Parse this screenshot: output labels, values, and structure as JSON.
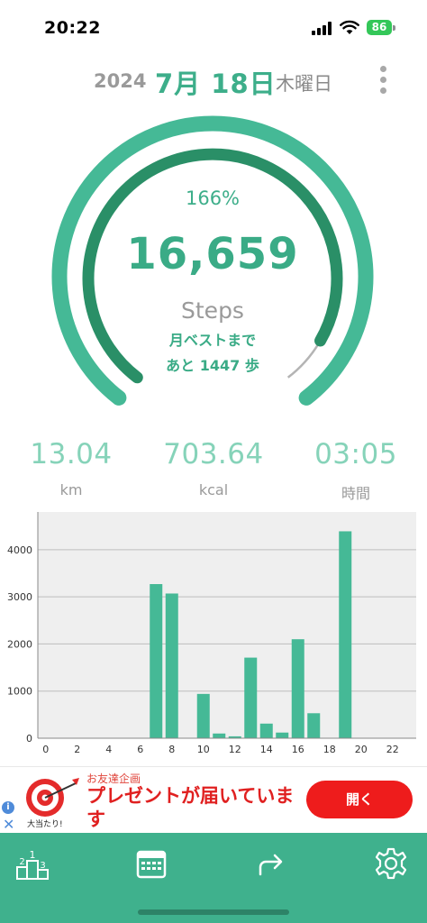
{
  "status": {
    "time": "20:22",
    "battery": "86"
  },
  "header": {
    "year": "2024",
    "date": "7月 18日",
    "weekday": "木曜日"
  },
  "gauge": {
    "percent_text": "166%",
    "steps": "16,659",
    "unit": "Steps",
    "note_line1": "月ベストまで",
    "note_line2": "あと 1447 歩",
    "progress_fraction": 0.92
  },
  "stats": [
    {
      "value": "13.04",
      "label": "km"
    },
    {
      "value": "703.64",
      "label": "kcal"
    },
    {
      "value": "03:05",
      "label": "時間"
    }
  ],
  "chart_data": {
    "type": "bar",
    "x": [
      0,
      1,
      2,
      3,
      4,
      5,
      6,
      7,
      8,
      9,
      10,
      11,
      12,
      13,
      14,
      15,
      16,
      17,
      18,
      19,
      20,
      21,
      22,
      23
    ],
    "values": [
      0,
      0,
      0,
      0,
      0,
      0,
      0,
      3270,
      3070,
      0,
      940,
      100,
      40,
      1710,
      310,
      120,
      2100,
      530,
      0,
      4390,
      0,
      0,
      0,
      0
    ],
    "xticks": [
      "0",
      "2",
      "4",
      "6",
      "8",
      "10",
      "12",
      "14",
      "16",
      "18",
      "20",
      "22"
    ],
    "yticks": [
      "0",
      "1000",
      "2000",
      "3000",
      "4000"
    ],
    "ylim": [
      0,
      4800
    ],
    "bar_color": "#45b996",
    "grid": true
  },
  "ad": {
    "small_text": "お友達企画",
    "headline": "プレゼントが届いています",
    "button": "開く",
    "logo_caption": "大当たり!",
    "info_icon": "i",
    "close_icon": "✕"
  },
  "colors": {
    "accent": "#3dae8a",
    "tabbar": "#3fb18d",
    "ad_button": "#ee1c1c"
  }
}
